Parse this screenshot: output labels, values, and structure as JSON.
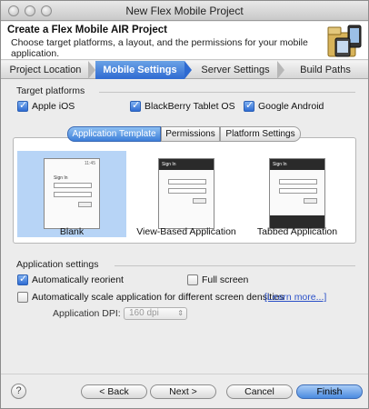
{
  "window": {
    "title": "New Flex Mobile Project"
  },
  "header": {
    "title": "Create a Flex Mobile AIR Project",
    "description": "Choose target platforms, a layout, and the permissions for your mobile application."
  },
  "steps": [
    "Project Location",
    "Mobile Settings",
    "Server Settings",
    "Build Paths"
  ],
  "target_platforms": {
    "label": "Target platforms",
    "items": [
      {
        "label": "Apple iOS",
        "checked": true
      },
      {
        "label": "BlackBerry Tablet OS",
        "checked": true
      },
      {
        "label": "Google Android",
        "checked": true
      }
    ]
  },
  "template_tabs": [
    "Application Template",
    "Permissions",
    "Platform Settings"
  ],
  "templates": [
    {
      "label": "Blank",
      "selected": true
    },
    {
      "label": "View-Based Application",
      "selected": false
    },
    {
      "label": "Tabbed Application",
      "selected": false
    }
  ],
  "phone": {
    "status": "11:45",
    "title": "Sign In"
  },
  "app_settings": {
    "label": "Application settings",
    "reorient_label": "Automatically reorient",
    "fullscreen_label": "Full screen",
    "scale_label": "Automatically scale application for different screen densities",
    "learn_more": "[Learn more...]",
    "dpi_label": "Application DPI:",
    "dpi_value": "160 dpi"
  },
  "footer": {
    "back": "< Back",
    "next": "Next >",
    "cancel": "Cancel",
    "finish": "Finish",
    "help": "?"
  }
}
